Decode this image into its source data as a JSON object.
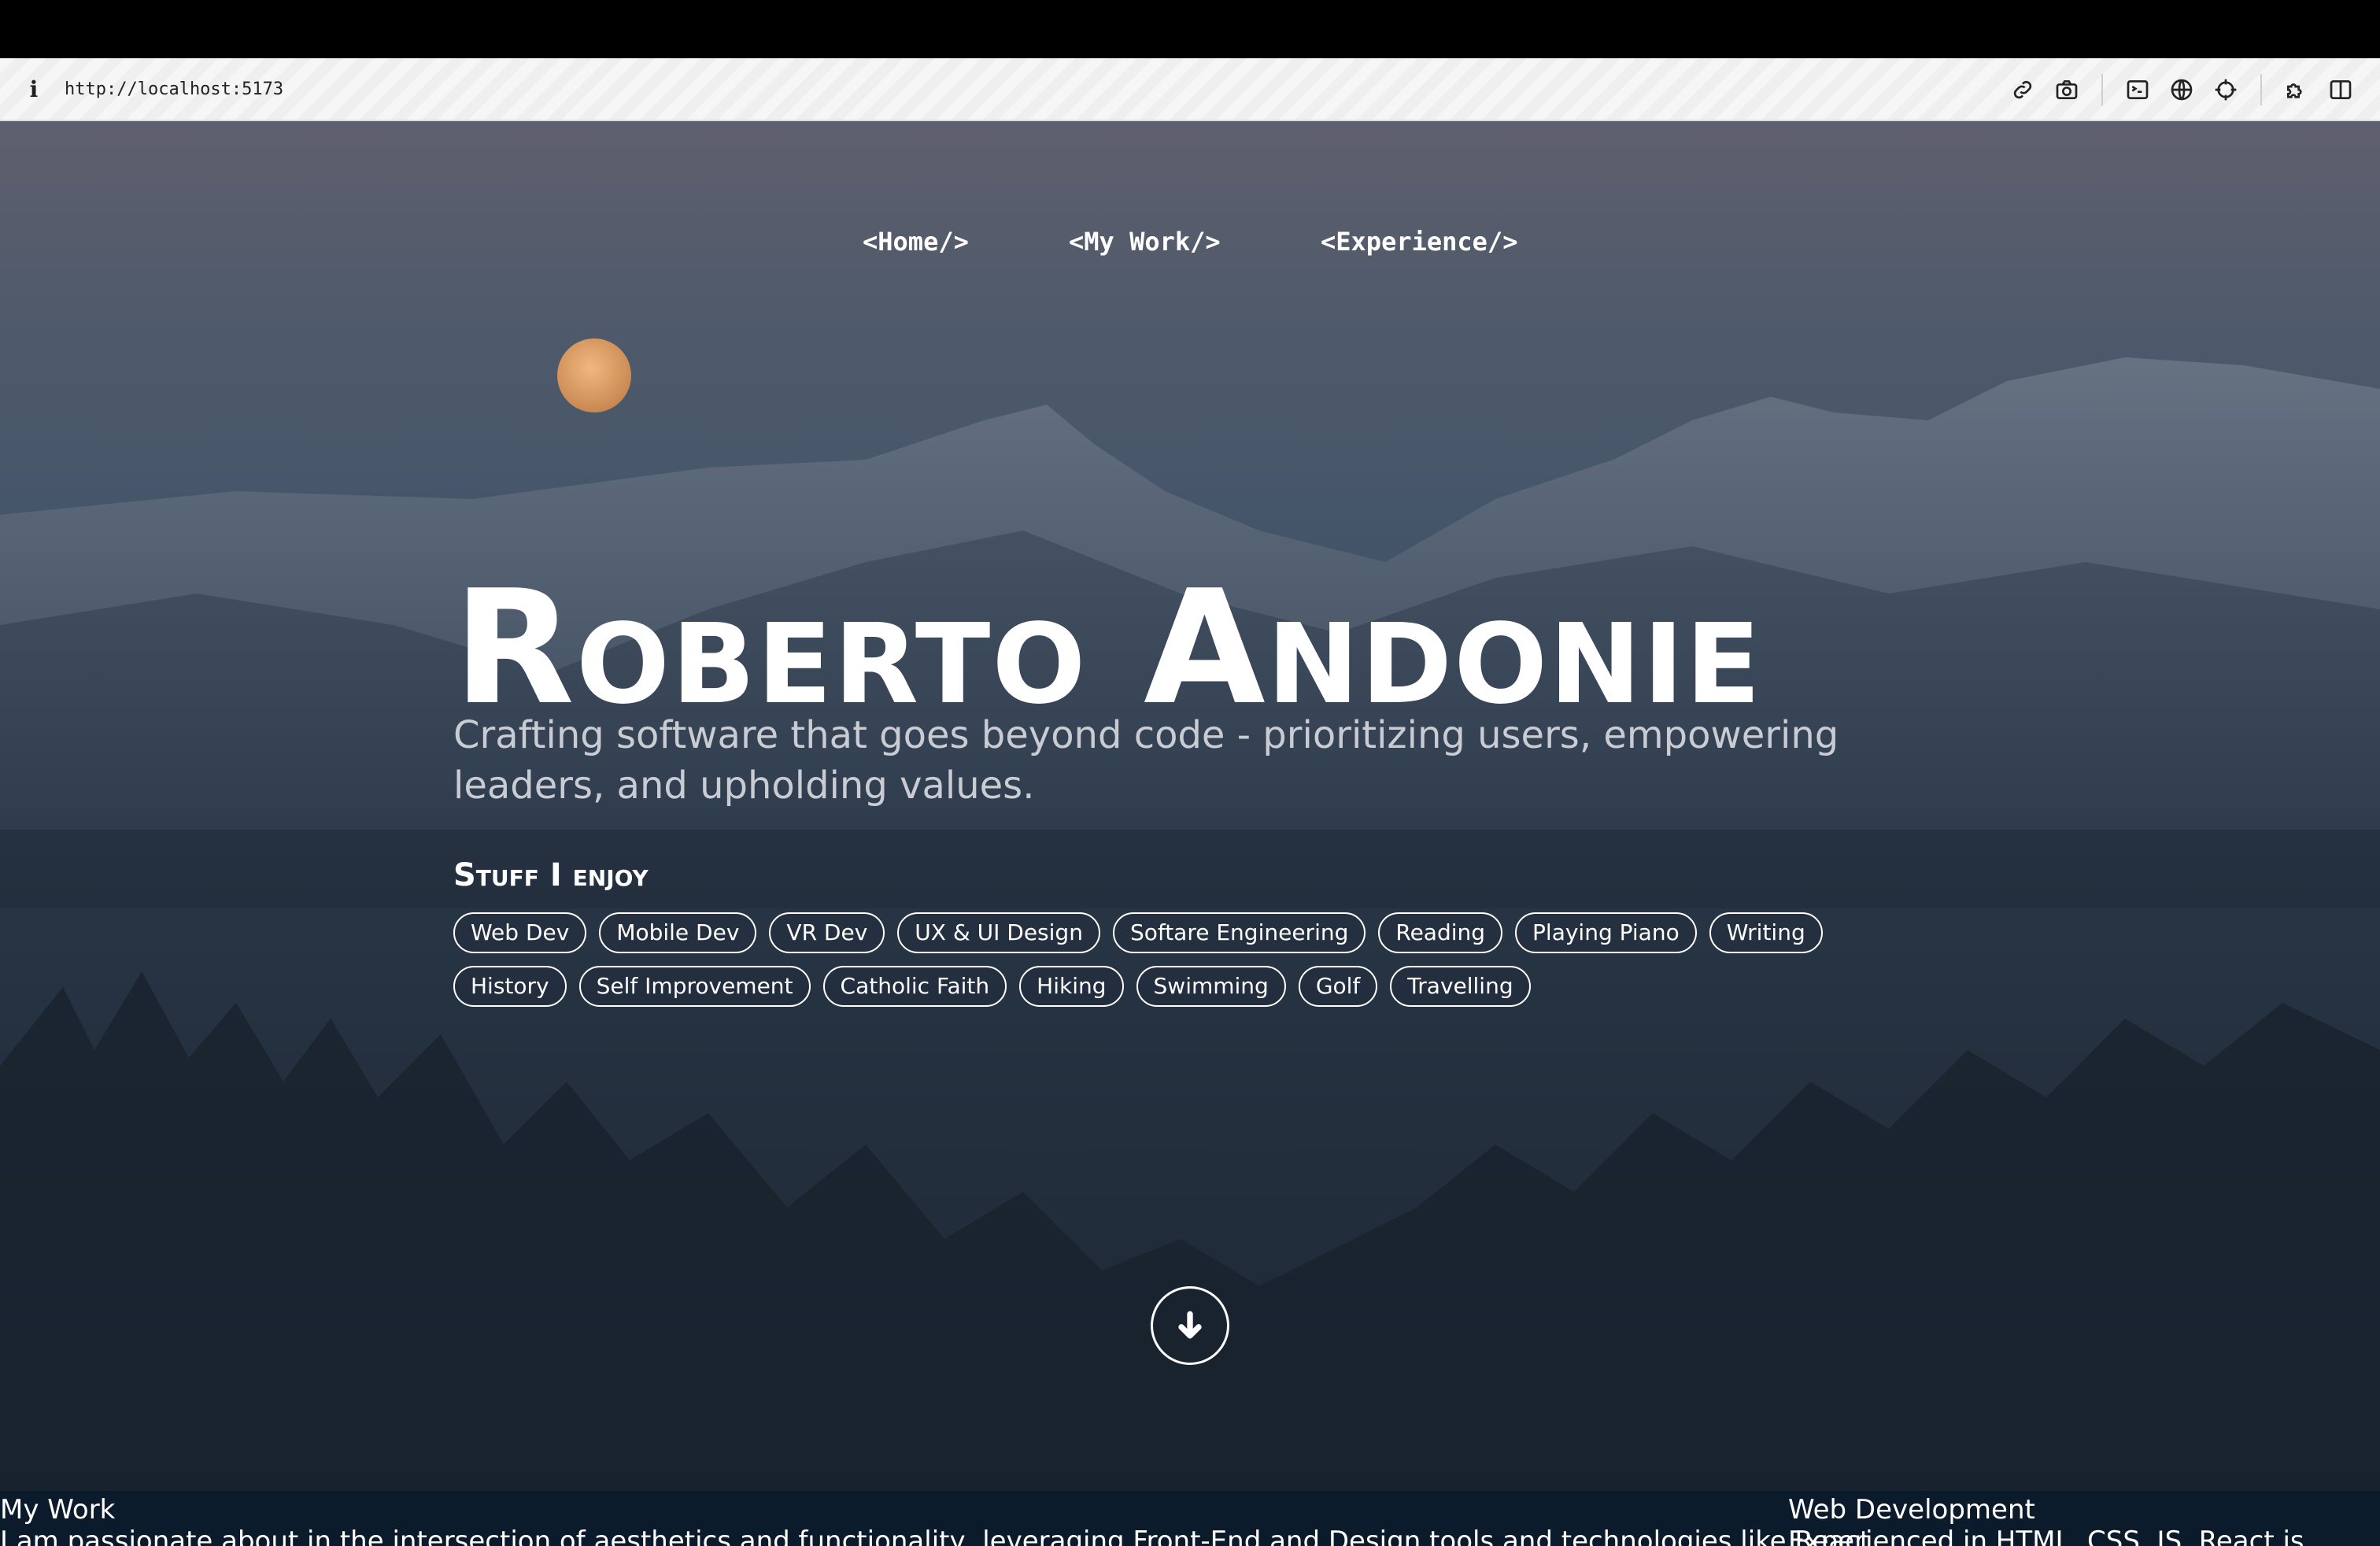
{
  "browser": {
    "url": "http://localhost:5173",
    "tools": [
      "link-icon",
      "camera-icon",
      "terminal-icon",
      "globe-icon",
      "crosshair-icon",
      "extensions-icon",
      "sidebar-icon"
    ]
  },
  "nav": {
    "home": "<Home/>",
    "work": "<My Work/>",
    "experience": "<Experience/>"
  },
  "hero": {
    "name": "Roberto Andonie",
    "tagline": "Crafting software that goes beyond code - prioritizing users, empowering leaders, and upholding values.",
    "enjoy_heading": "Stuff I enjoy",
    "tags": [
      "Web Dev",
      "Mobile Dev",
      "VR Dev",
      "UX & UI Design",
      "Softare Engineering",
      "Reading",
      "Playing Piano",
      "Writing",
      "History",
      "Self Improvement",
      "Catholic Faith",
      "Hiking",
      "Swimming",
      "Golf",
      "Travelling"
    ]
  },
  "sections": {
    "my_work_title": "My Work",
    "my_work_text": "I am passionate about in the intersection of aesthetics and functionality, leveraging Front-End and Design tools and technologies like React",
    "web_dev_title": "Web Development",
    "web_dev_text": "Experienced in HTML, CSS, JS, React is"
  },
  "colors": {
    "moon": "#e6a56e",
    "section_bg": "#0c1b2c"
  }
}
